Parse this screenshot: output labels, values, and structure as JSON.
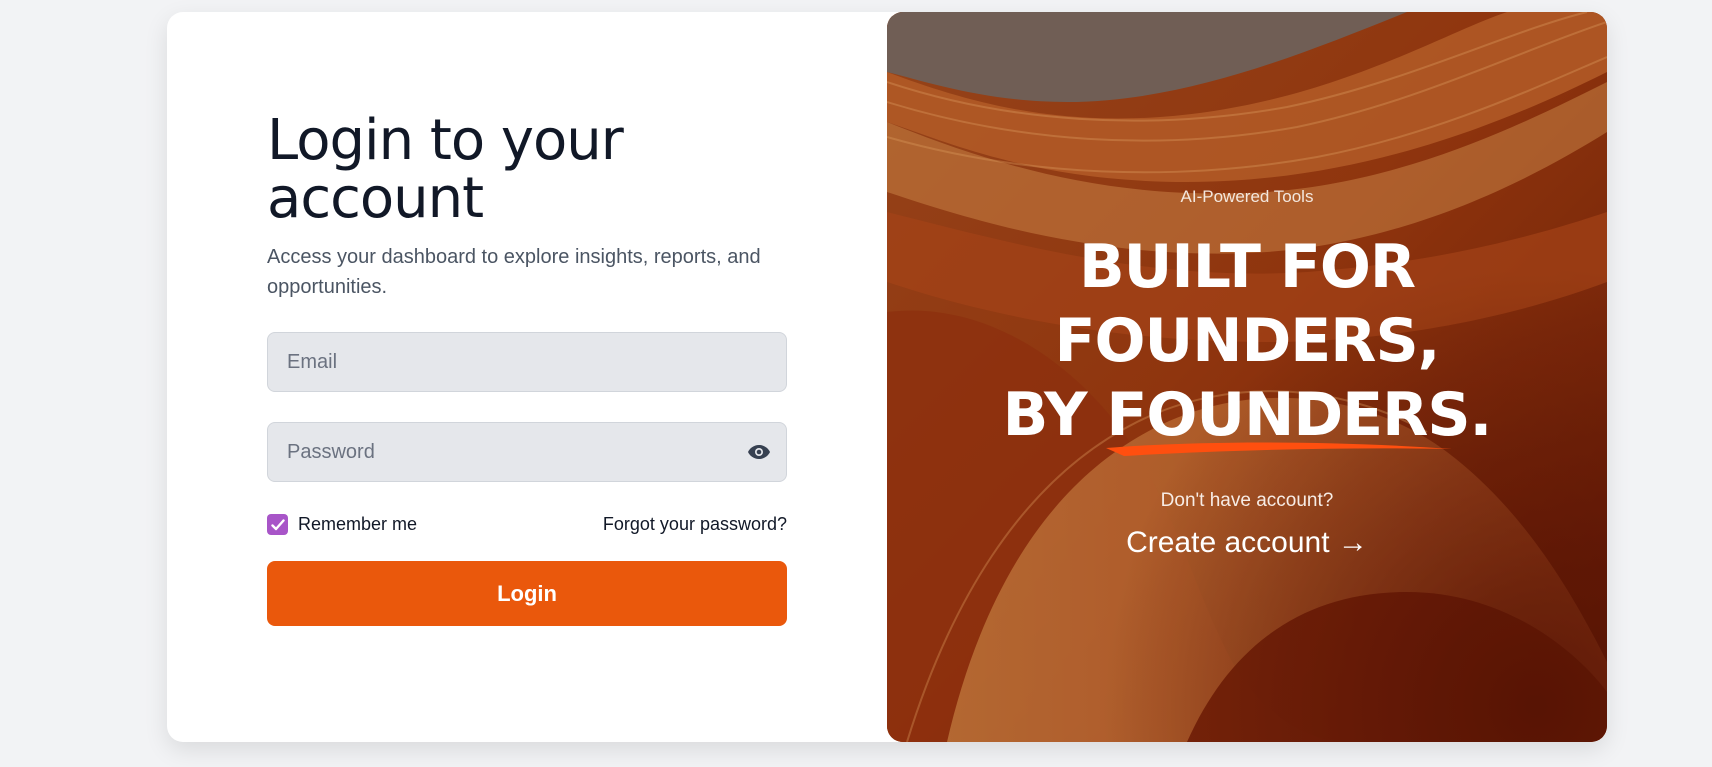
{
  "login": {
    "title": "Login to your account",
    "subtitle": "Access your dashboard to explore insights, reports, and opportunities.",
    "email_placeholder": "Email",
    "password_placeholder": "Password",
    "remember_label": "Remember me",
    "remember_checked": true,
    "forgot_label": "Forgot your password?",
    "login_button": "Login"
  },
  "promo": {
    "eyebrow": "AI-Powered Tools",
    "headline_line1": "BUILT FOR",
    "headline_line2": "FOUNDERS,",
    "headline_line3_prefix": "BY ",
    "headline_line3_word": "FOUNDERS.",
    "no_account": "Don't have account?",
    "create_account": "Create account →"
  },
  "icons": {
    "password_toggle": "eye-icon",
    "checkbox": "check-icon"
  },
  "colors": {
    "accent": "#ea580c",
    "checkbox": "#a855c8",
    "title": "#111827",
    "swoosh": "#ff4f0f"
  }
}
